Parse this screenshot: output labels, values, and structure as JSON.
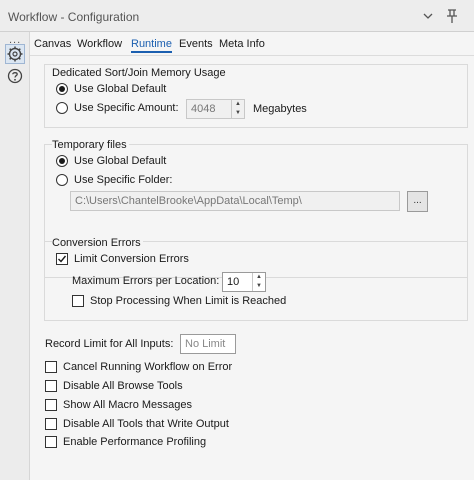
{
  "window": {
    "title": "Workflow - Configuration",
    "controls": {
      "dropdown": "▾",
      "pin": "📌"
    }
  },
  "sidebar": {
    "dots": "...",
    "items": [
      {
        "icon": "gear-icon",
        "active": true
      },
      {
        "icon": "help-icon",
        "active": false
      }
    ]
  },
  "tabs": [
    {
      "label": "Canvas",
      "active": false
    },
    {
      "label": "Workflow",
      "active": false
    },
    {
      "label": "Runtime",
      "active": true
    },
    {
      "label": "Events",
      "active": false
    },
    {
      "label": "Meta Info",
      "active": false
    }
  ],
  "memory": {
    "title": "Dedicated Sort/Join Memory Usage",
    "global_label": "Use Global Default",
    "specific_label": "Use Specific Amount:",
    "amount": "4048",
    "unit": "Megabytes",
    "selected": "global"
  },
  "temp": {
    "title": "Temporary files",
    "global_label": "Use Global Default",
    "specific_label": "Use Specific Folder:",
    "folder_path": "C:\\Users\\ChantelBrooke\\AppData\\Local\\Temp\\",
    "browse_label": "...",
    "selected": "global"
  },
  "conversion": {
    "title": "Conversion Errors",
    "limit_label": "Limit Conversion Errors",
    "limit_checked": true,
    "max_label": "Maximum Errors per Location:",
    "max_value": "10",
    "stop_label": "Stop Processing When Limit is Reached",
    "stop_checked": false
  },
  "record_limit": {
    "label": "Record Limit for All Inputs:",
    "placeholder": "No Limit"
  },
  "options": [
    {
      "label": "Cancel Running Workflow on Error",
      "checked": false
    },
    {
      "label": "Disable All Browse Tools",
      "checked": false
    },
    {
      "label": "Show All Macro Messages",
      "checked": false
    },
    {
      "label": "Disable All Tools that Write Output",
      "checked": false
    },
    {
      "label": "Enable Performance Profiling",
      "checked": false
    }
  ]
}
